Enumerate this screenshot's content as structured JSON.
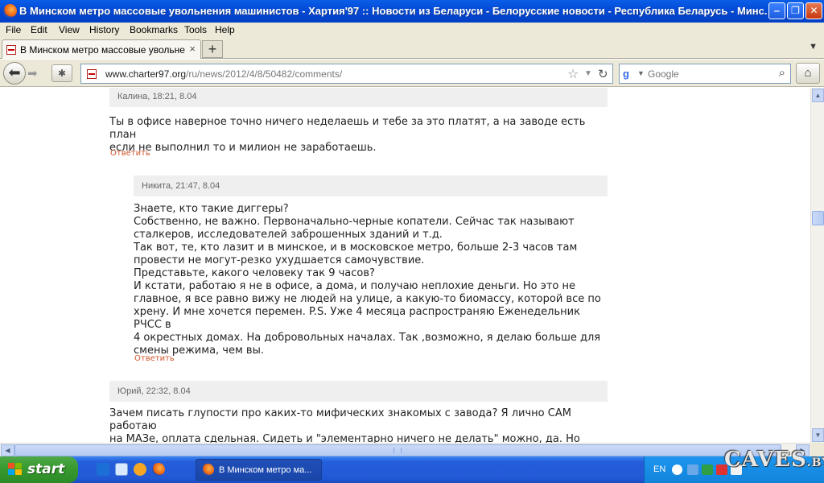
{
  "window": {
    "title": "В Минском метро массовые увольнения машинистов - Хартия'97 :: Новости из Беларуси - Белорусские новости - Республика Беларусь - Минс...",
    "minimize": "‒",
    "maximize": "❐",
    "close": "✕"
  },
  "menu": {
    "items": [
      {
        "label": "File"
      },
      {
        "label": "Edit"
      },
      {
        "label": "View"
      },
      {
        "label": "History"
      },
      {
        "label": "Bookmarks"
      },
      {
        "label": "Tools"
      },
      {
        "label": "Help"
      }
    ]
  },
  "tabs": [
    {
      "label": "В Минском метро массовые увольнения ма...",
      "close": "×"
    }
  ],
  "newtab_label": "+",
  "nav": {
    "url_host": "www.charter97.org",
    "url_path": "/ru/news/2012/4/8/50482/comments/",
    "search_placeholder": "Google",
    "search_engine_letter": "g"
  },
  "comments": [
    {
      "author": "Калина, 18:21, 8.04",
      "text": "Ты в офисе наверное точно ничего неделаешь и тебе за это платят, а на заводе есть план\nесли не выполнил то и милион не заработаешь.",
      "reply": "Ответить"
    },
    {
      "author": "Никита, 21:47, 8.04",
      "text": "Знаете, кто такие диггеры?\nСобственно, не важно. Первоначально-черные копатели. Сейчас так называют\nсталкеров, исследователей заброшенных зданий и т.д.\nТак вот, те, кто лазит и в минское, и в московское метро, больше 2-3 часов там\nпровести не могут-резко ухудшается самочувствие.\nПредставьте, какого человеку так 9 часов?\nИ кстати, работаю я не в офисе, а дома, и получаю неплохие деньги. Но это не\nглавное, я все равно вижу не людей на улице, а какую-то биомассу, которой все по\nхрену. И мне хочется перемен. P.S. Уже 4 месяца распространяю Еженедельник РЧСС в\n4 окрестных домах. На добровольных началах. Так ,возможно, я делаю больше для\nсмены режима, чем вы.",
      "reply": "Ответить"
    },
    {
      "author": "Юрий, 22:32, 8.04",
      "text": "Зачем писать глупости про каких-то мифических знакомых с завода? Я лично САМ работаю\nна МАЗе, оплата сдельная. Сидеть и \"элементарно ничего не делать\" можно, да. Но когда\nполучишь расчетный листок, будешь неприятно удивлен разницей в зарплате с остальной"
    }
  ],
  "taskbar": {
    "start_label": "start",
    "task_label": "В Минском метро ма...",
    "language": "EN"
  },
  "watermark": {
    "main": "CAVES",
    "suffix": ".BY"
  },
  "colors": {
    "titlebar": "#0349d6",
    "reply_link": "#d0552a",
    "comment_header_bg": "#efefef",
    "start_green": "#379a2f"
  }
}
